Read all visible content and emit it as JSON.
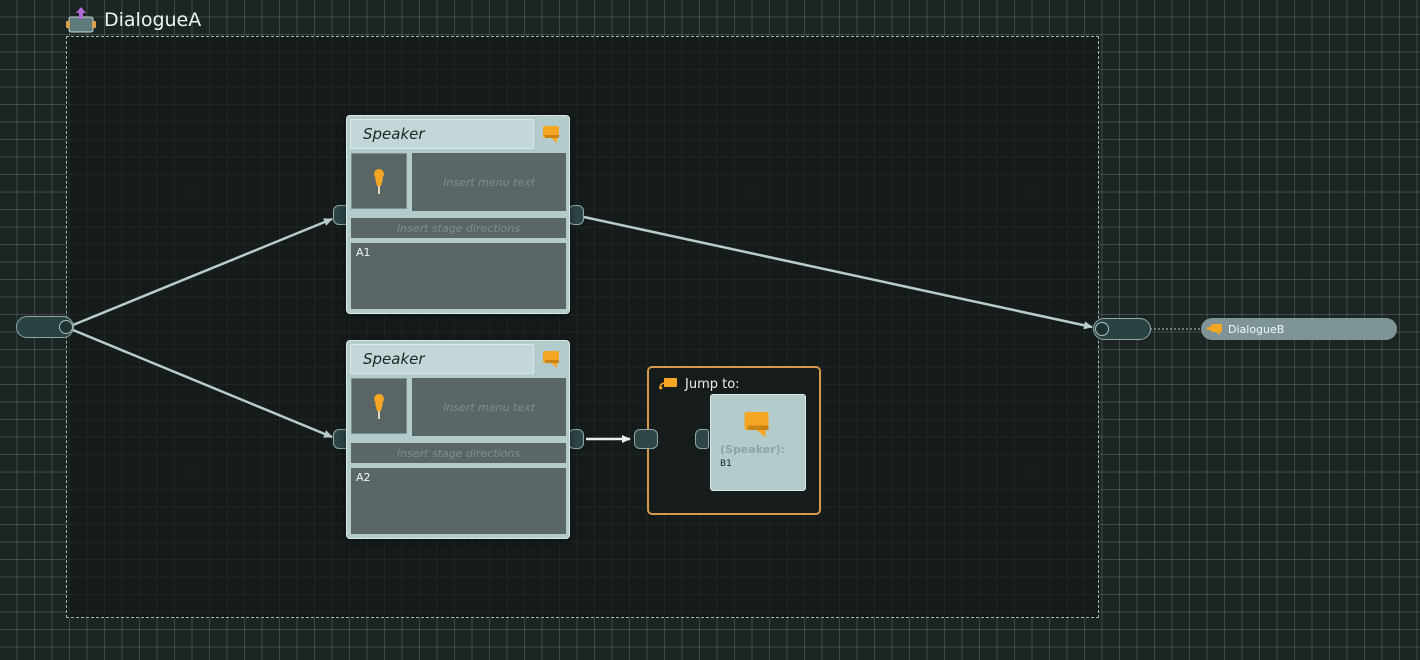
{
  "flow": {
    "container_name": "DialogueA",
    "container_icon": "flow-fragment-icon"
  },
  "nodes": [
    {
      "speaker": "Speaker",
      "menu_text_placeholder": "Insert menu text",
      "stage_directions_placeholder": "Insert stage directions",
      "text": "A1",
      "portrait_icon": "pin-icon",
      "type_icon": "speech-bubble-icon"
    },
    {
      "speaker": "Speaker",
      "menu_text_placeholder": "Insert menu text",
      "stage_directions_placeholder": "Insert stage directions",
      "text": "A2",
      "portrait_icon": "pin-icon",
      "type_icon": "speech-bubble-icon"
    }
  ],
  "jump": {
    "label": "Jump to:",
    "target_speaker": "(Speaker):",
    "target_text": "B1",
    "icon": "jump-icon"
  },
  "target_reference": {
    "label": "DialogueB",
    "icon": "speech-bubble-icon"
  },
  "colors": {
    "node_body": "#b4cbcc",
    "field": "#5b6767",
    "accent_orange": "#f5a623",
    "jump_border": "#d29a4a",
    "flow_icon_purple": "#b06bd8"
  }
}
